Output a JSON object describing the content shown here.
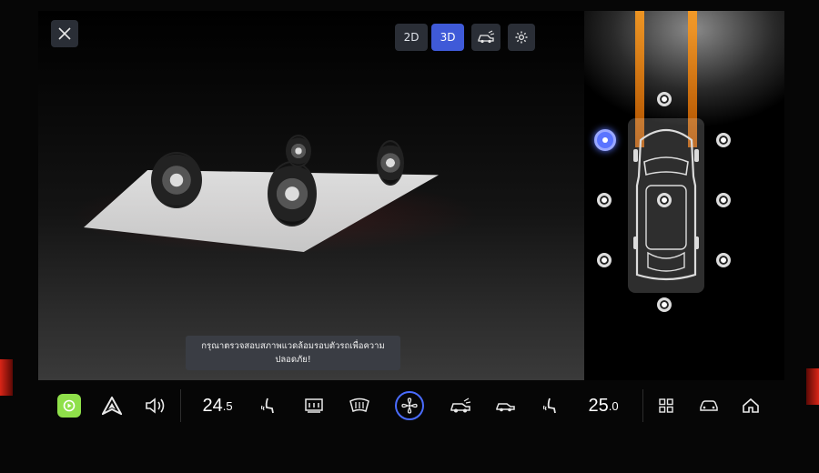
{
  "view_mode": {
    "option_2d": "2D",
    "option_3d": "3D",
    "selected": "3D",
    "accent_color": "#3f5ad8"
  },
  "toolbar": {
    "close_icon": "close-icon",
    "car_view_icon": "car-view-icon",
    "settings_icon": "gear-icon"
  },
  "toast": {
    "line1": "กรุณาตรวจสอบสภาพแวดล้อมรอบตัวรถเพื่อความ",
    "line2": "ปลอดภัย!"
  },
  "camera_selector": {
    "positions": [
      "front",
      "front-left",
      "front-right",
      "left",
      "center",
      "right",
      "rear-left",
      "rear-right",
      "rear"
    ],
    "active": "front-left",
    "active_color": "#5a74ff"
  },
  "dock": {
    "carplay_icon": "carplay-icon",
    "android_auto_icon": "android-auto-icon",
    "volume_icon": "volume-icon",
    "driver_temp_main": "24",
    "driver_temp_decimal": ".5",
    "driver_seat_heat_icon": "seat-heat-icon",
    "rear_defrost_icon": "rear-defrost-icon",
    "front_defrost_icon": "front-defrost-icon",
    "fan_icon": "fan-icon",
    "car_camera_icon": "car-camera-icon",
    "car_lights_icon": "car-lights-icon",
    "passenger_seat_heat_icon": "seat-heat-icon",
    "passenger_temp_main": "25",
    "passenger_temp_decimal": ".0",
    "apps_icon": "apps-grid-icon",
    "vehicle_icon": "vehicle-icon",
    "home_icon": "home-icon",
    "carplay_color": "#8fe04a"
  }
}
